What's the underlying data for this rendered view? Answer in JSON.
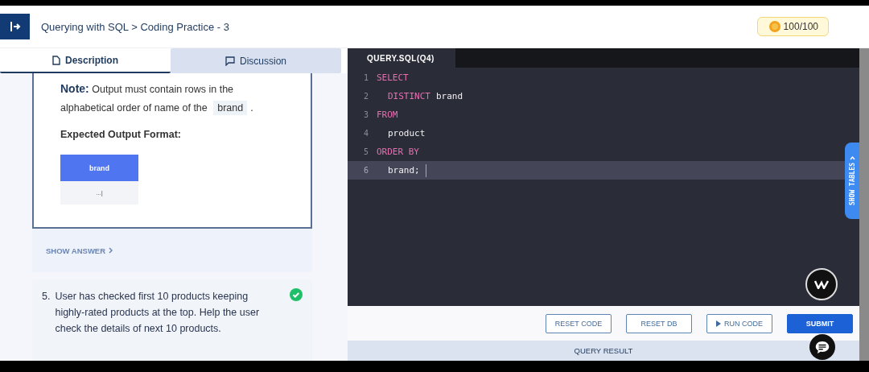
{
  "header": {
    "breadcrumb": "Querying with SQL > Coding Practice - 3",
    "score": "100/100"
  },
  "tabs": [
    {
      "label": "Description",
      "selected": true,
      "kind": "document"
    },
    {
      "label": "Discussion",
      "selected": false,
      "kind": "chat"
    }
  ],
  "question": {
    "note": "**Note:** Output must contain rows in the alphabetical order of name of the",
    "note_code": "brand",
    "note_end": ".",
    "expected_title": "Expected Output Format:",
    "output_table": {
      "columns": [
        "brand"
      ],
      "rows": [
        [
          "...|"
        ]
      ]
    },
    "show_answer": "SHOW ANSWER"
  },
  "next_question": {
    "number": "5.",
    "text": "User has checked first 10 products keeping highly-rated products at the top. Help the user check the details of next 10 products.",
    "completed": true
  },
  "editor": {
    "file_tab": "QUERY.SQL(Q4)",
    "show_tables": "SHOW TABLES",
    "lines": [
      {
        "number": "1",
        "indented": false,
        "active": false,
        "tokens": [
          {
            "text": "SELECT",
            "kind": "keyword"
          }
        ]
      },
      {
        "number": "2",
        "indented": true,
        "active": false,
        "tokens": [
          {
            "text": "DISTINCT",
            "kind": "keyword"
          },
          {
            "text": "brand",
            "kind": "plain"
          }
        ]
      },
      {
        "number": "3",
        "indented": false,
        "active": false,
        "tokens": [
          {
            "text": "FROM",
            "kind": "keyword"
          }
        ]
      },
      {
        "number": "4",
        "indented": true,
        "active": false,
        "tokens": [
          {
            "text": "product",
            "kind": "plain"
          }
        ]
      },
      {
        "number": "5",
        "indented": false,
        "active": false,
        "tokens": [
          {
            "text": "ORDER BY",
            "kind": "keyword"
          }
        ]
      },
      {
        "number": "6",
        "indented": true,
        "active": true,
        "tokens": [
          {
            "text": "brand;",
            "kind": "plain"
          }
        ]
      }
    ]
  },
  "buttons": [
    {
      "label": "RESET CODE",
      "kind": "outline"
    },
    {
      "label": "RESET DB",
      "kind": "outline"
    },
    {
      "label": "RUN CODE",
      "kind": "run"
    },
    {
      "label": "SUBMIT",
      "kind": "primary"
    }
  ],
  "result_bar": "QUERY RESULT"
}
